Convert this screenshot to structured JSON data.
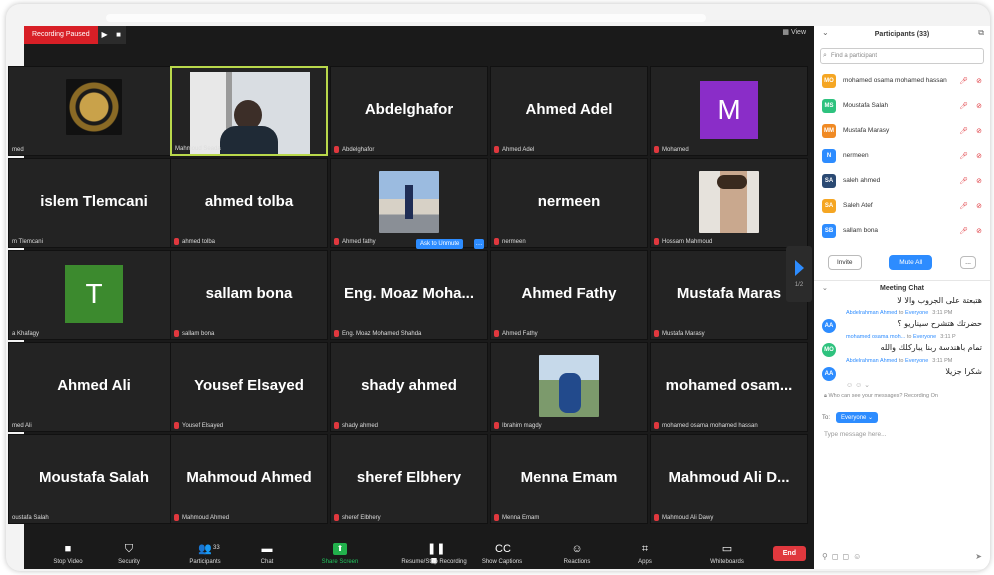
{
  "recording": {
    "label": "Recording Paused"
  },
  "view_label": "View",
  "tiles": [
    {
      "name": "",
      "label": "med",
      "type": "logo"
    },
    {
      "name": "",
      "label": "Mahmoud Seada",
      "type": "photo",
      "active": true
    },
    {
      "name": "Abdelghafor",
      "label": "Abdelghafor",
      "type": "text",
      "muted": true
    },
    {
      "name": "Ahmed Adel",
      "label": "Ahmed Adel",
      "type": "text",
      "muted": true
    },
    {
      "name": "M",
      "label": "Mohamed",
      "type": "letter",
      "color": "#8a2dc8",
      "muted": true
    },
    {
      "name": "islem Tlemcani",
      "label": "m Tlemcani",
      "type": "text"
    },
    {
      "name": "ahmed tolba",
      "label": "ahmed tolba",
      "type": "text",
      "muted": true
    },
    {
      "name": "",
      "label": "Ahmed fathy",
      "type": "photo2",
      "muted": true
    },
    {
      "name": "nermeen",
      "label": "nermeen",
      "type": "text",
      "muted": true
    },
    {
      "name": "",
      "label": "Hossam Mahmoud",
      "type": "photo3",
      "muted": true
    },
    {
      "name": "T",
      "label": "a Khafagy",
      "type": "letter",
      "color": "#3c8a2e"
    },
    {
      "name": "sallam bona",
      "label": "sallam bona",
      "type": "text",
      "muted": true
    },
    {
      "name": "Eng. Moaz Moha...",
      "label": "Eng. Moaz Mohamed Shahda",
      "type": "text",
      "muted": true,
      "unmute": true
    },
    {
      "name": "Ahmed Fathy",
      "label": "Ahmed Fathy",
      "type": "text",
      "muted": true
    },
    {
      "name": "Mustafa Maras",
      "label": "Mustafa Marasy",
      "type": "text",
      "muted": true
    },
    {
      "name": "Ahmed Ali",
      "label": "med Ali",
      "type": "text"
    },
    {
      "name": "Yousef Elsayed",
      "label": "Yousef Elsayed",
      "type": "text",
      "muted": true
    },
    {
      "name": "shady ahmed",
      "label": "shady ahmed",
      "type": "text",
      "muted": true
    },
    {
      "name": "",
      "label": "Ibrahim magdy",
      "type": "photo4",
      "muted": true
    },
    {
      "name": "mohamed osam...",
      "label": "mohamed osama mohamed hassan",
      "type": "text",
      "muted": true
    },
    {
      "name": "Moustafa Salah",
      "label": "oustafa Salah",
      "type": "text"
    },
    {
      "name": "Mahmoud Ahmed",
      "label": "Mahmoud Ahmed",
      "type": "text",
      "muted": true
    },
    {
      "name": "sheref Elbhery",
      "label": "sheref Elbhery",
      "type": "text",
      "muted": true
    },
    {
      "name": "Menna Emam",
      "label": "Menna Emam",
      "type": "text",
      "muted": true
    },
    {
      "name": "Mahmoud Ali D...",
      "label": "Mahmoud Ali Dawy",
      "type": "text",
      "muted": true
    }
  ],
  "unmute_label": "Ask to Unmute",
  "page_indicator": "1/2",
  "toolbar": {
    "items": [
      {
        "label": "Stop Video",
        "icon": "■"
      },
      {
        "label": "Security",
        "icon": "⛉"
      },
      {
        "label": "Participants",
        "icon": "👥",
        "count": "33"
      },
      {
        "label": "Chat",
        "icon": "▬"
      },
      {
        "label": "Share Screen",
        "icon": "⬆",
        "green": true
      },
      {
        "label": "Resume/Stop Recording",
        "icon": "❚❚ ■"
      },
      {
        "label": "Show Captions",
        "icon": "CC"
      },
      {
        "label": "Reactions",
        "icon": "☺"
      },
      {
        "label": "Apps",
        "icon": "⌗"
      },
      {
        "label": "Whiteboards",
        "icon": "▭"
      }
    ],
    "end_label": "End"
  },
  "panel": {
    "title": "Participants (33)",
    "search_placeholder": "Find a participant",
    "participants": [
      {
        "initials": "MO",
        "name": "mohamed osama mohamed hassan",
        "color": "#f5a623"
      },
      {
        "initials": "MS",
        "name": "Moustafa Salah",
        "color": "#2ec27e"
      },
      {
        "initials": "MM",
        "name": "Mustafa Marasy",
        "color": "#f08a24"
      },
      {
        "initials": "N",
        "name": "nermeen",
        "color": "#2d8cff"
      },
      {
        "initials": "SA",
        "name": "saleh ahmed",
        "color": "#2b4a73"
      },
      {
        "initials": "SA",
        "name": "Saleh Atef",
        "color": "#f5a623"
      },
      {
        "initials": "SB",
        "name": "sallam bona",
        "color": "#2d8cff"
      }
    ],
    "invite_label": "Invite",
    "mute_all_label": "Mute All",
    "more_label": "...",
    "chat_title": "Meeting Chat",
    "first_message": "هتبعتة على الجروب والا لا",
    "messages": [
      {
        "initials": "AA",
        "from": "Abdelrahman Ahmed",
        "to": "to",
        "to_whom": "Everyone",
        "time": "3:11 PM",
        "text": "حضرتك هتشرح سيناريو ؟",
        "color": "#2d8cff"
      },
      {
        "initials": "MO",
        "from": "mohamed osama moh...",
        "to": "to",
        "to_whom": "Everyone",
        "time": "3:11 P",
        "text": "تمام باهندسة ربنا يباركلك والله",
        "color": "#2ec27e"
      },
      {
        "initials": "AA",
        "from": "Abdelrahman Ahmed",
        "to": "to",
        "to_whom": "Everyone",
        "time": "3:11 PM",
        "text": "شكرا جزيلا",
        "color": "#2d8cff"
      }
    ],
    "secure_note": "Who can see your messages? Recording On",
    "to_label": "To:",
    "to_target": "Everyone",
    "type_placeholder": "Type message here..."
  }
}
